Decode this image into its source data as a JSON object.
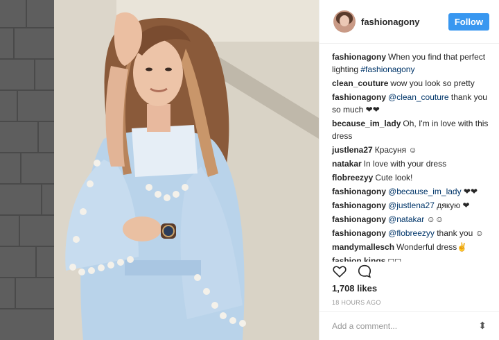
{
  "header": {
    "username": "fashionagony",
    "follow_label": "Follow"
  },
  "comments": [
    {
      "user": "fashionagony",
      "text": "When you find that perfect lighting ",
      "mention": "#fashionagony",
      "tail": ""
    },
    {
      "user": "clean_couture",
      "text": "wow you look so pretty",
      "mention": "",
      "tail": ""
    },
    {
      "user": "fashionagony",
      "text": "",
      "mention": "@clean_couture",
      "tail": " thank you so much ❤❤"
    },
    {
      "user": "because_im_lady",
      "text": "Oh, I'm in love with this dress",
      "mention": "",
      "tail": ""
    },
    {
      "user": "justlena27",
      "text": "Красуня ☺",
      "mention": "",
      "tail": ""
    },
    {
      "user": "natakar",
      "text": "In love with your dress",
      "mention": "",
      "tail": ""
    },
    {
      "user": "flobreezyy",
      "text": "Cute look!",
      "mention": "",
      "tail": ""
    },
    {
      "user": "fashionagony",
      "text": "",
      "mention": "@because_im_lady",
      "tail": " ❤❤"
    },
    {
      "user": "fashionagony",
      "text": "",
      "mention": "@justlena27",
      "tail": " дякую ❤"
    },
    {
      "user": "fashionagony",
      "text": "",
      "mention": "@natakar",
      "tail": " ☺☺"
    },
    {
      "user": "fashionagony",
      "text": "",
      "mention": "@flobreezyy",
      "tail": " thank you ☺"
    },
    {
      "user": "mandymallesch",
      "text": "Wonderful dress✌",
      "mention": "",
      "tail": ""
    },
    {
      "user": "fashion.kings",
      "text": "◻◻",
      "mention": "",
      "tail": ""
    }
  ],
  "actions": {
    "like_icon": "heart-icon",
    "comment_icon": "comment-icon"
  },
  "likes": "1,708 likes",
  "timestamp": "18 HOURS AGO",
  "add_comment": {
    "placeholder": "Add a comment...",
    "more_icon": "more-icon",
    "more_glyph": "⬍"
  }
}
